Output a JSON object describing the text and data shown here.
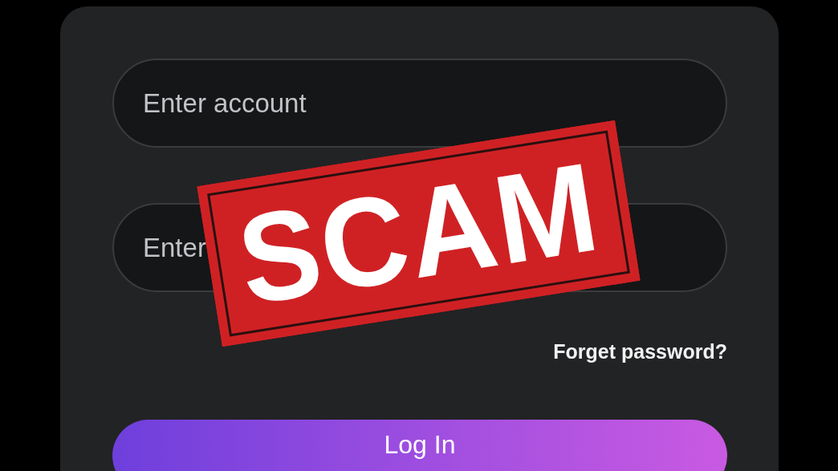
{
  "login_form": {
    "account_field": {
      "placeholder": "Enter account"
    },
    "password_field": {
      "placeholder": "Enter"
    },
    "forgot_password_link": "Forget password?",
    "login_button": "Log In"
  },
  "stamp": {
    "text": "SCAM"
  }
}
